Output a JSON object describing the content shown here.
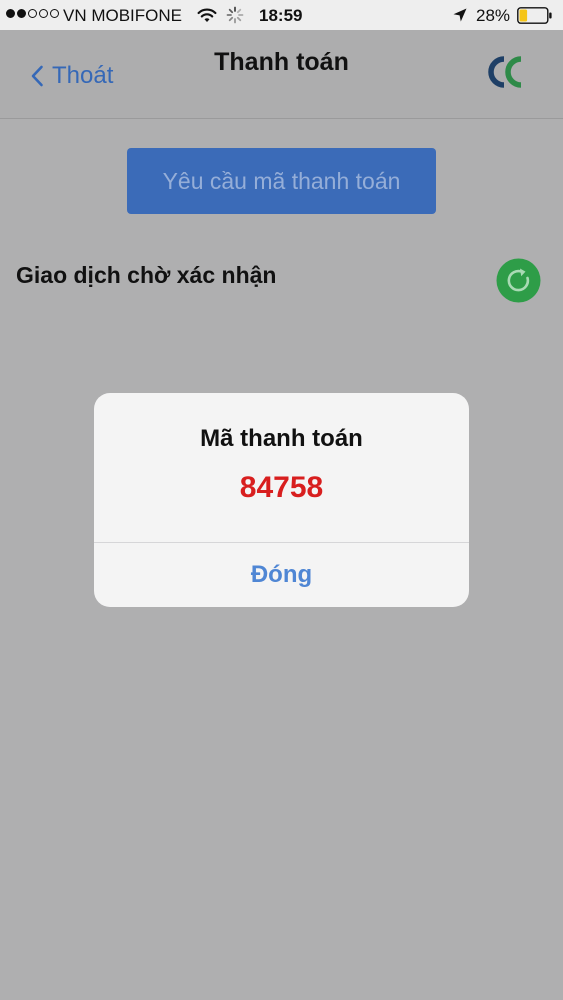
{
  "status_bar": {
    "signal_bars_filled": 2,
    "signal_bars_total": 5,
    "carrier": "VN MOBIFONE",
    "time": "18:59",
    "battery": "28%",
    "battery_level": 0.28,
    "icons": [
      "signal-dots-icon",
      "wifi-icon",
      "activity-spinner-icon",
      "location-arrow-icon",
      "battery-icon"
    ]
  },
  "nav": {
    "back_label": "Thoát",
    "title": "Thanh toán",
    "logo_icon": "cc-logo-icon"
  },
  "main": {
    "request_button_label": "Yêu cầu mã thanh toán",
    "pending_label": "Giao dịch chờ xác nhận",
    "refresh_icon": "refresh-icon"
  },
  "dialog": {
    "title": "Mã thanh toán",
    "code": "84758",
    "close_label": "Đóng"
  },
  "colors": {
    "overlay_background": "#afafb0",
    "accent_blue": "#3b6bb8",
    "link_blue": "#4f86d4",
    "code_red": "#d81e1e",
    "refresh_green": "#2e9d48",
    "battery_yellow": "#f5c518"
  }
}
